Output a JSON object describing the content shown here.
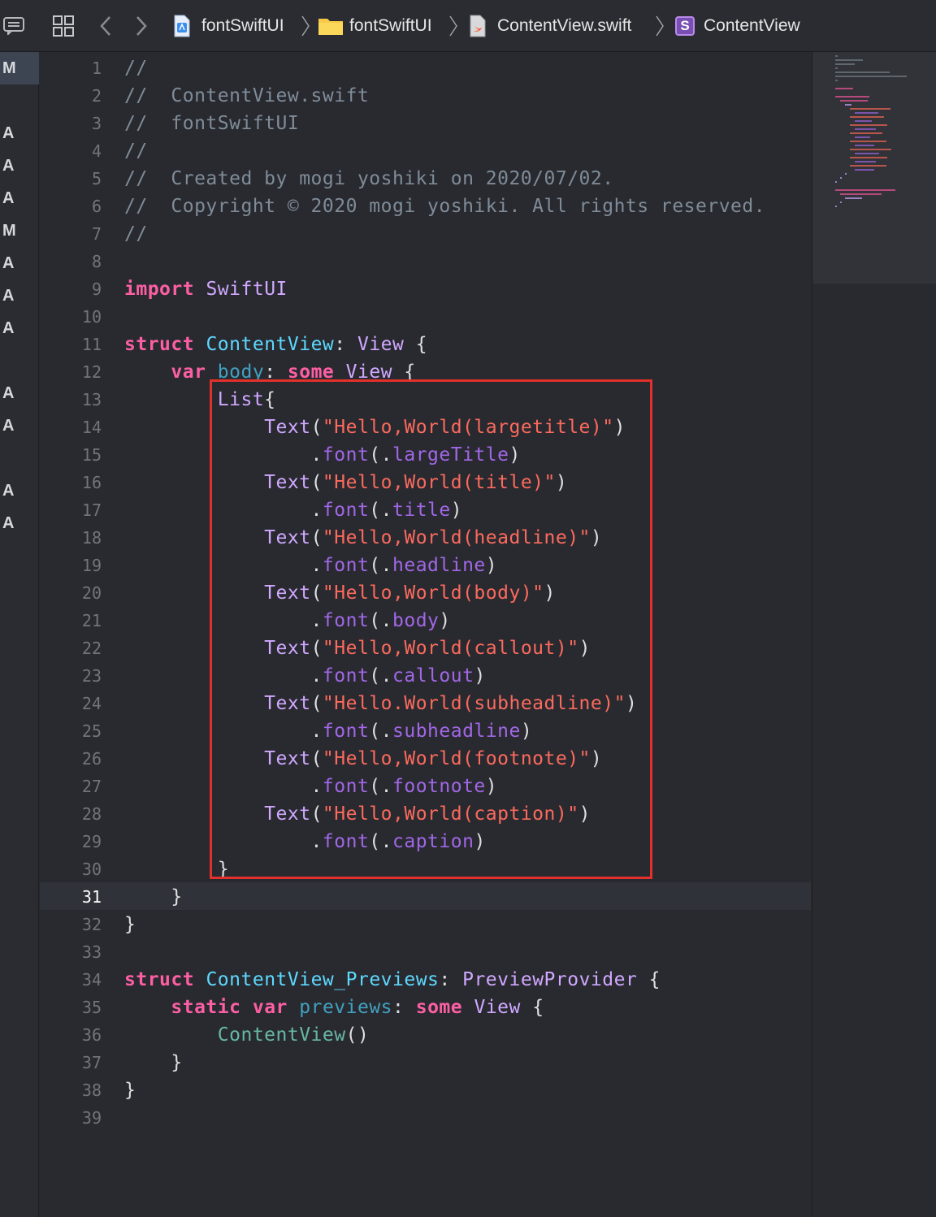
{
  "jumpbar": {
    "crumbs": [
      {
        "label": "fontSwiftUI",
        "icon": "project-file-icon"
      },
      {
        "label": "fontSwiftUI",
        "icon": "folder-icon"
      },
      {
        "label": "ContentView.swift",
        "icon": "swift-file-icon"
      },
      {
        "label": "ContentView",
        "icon": "struct-symbol-icon"
      }
    ],
    "struct_badge": "S"
  },
  "status_markers": [
    "M",
    "A",
    "A",
    "A",
    "M",
    "A",
    "A",
    "A",
    "A",
    "A",
    "A",
    "A"
  ],
  "editor": {
    "current_line": 31,
    "lines": [
      {
        "n": "1",
        "code": "//"
      },
      {
        "n": "2",
        "code": "//  ContentView.swift"
      },
      {
        "n": "3",
        "code": "//  fontSwiftUI"
      },
      {
        "n": "4",
        "code": "//"
      },
      {
        "n": "5",
        "code": "//  Created by mogi yoshiki on 2020/07/02."
      },
      {
        "n": "6",
        "code": "//  Copyright © 2020 mogi yoshiki. All rights reserved."
      },
      {
        "n": "7",
        "code": "//"
      },
      {
        "n": "8",
        "code": ""
      },
      {
        "n": "9",
        "code": "import SwiftUI"
      },
      {
        "n": "10",
        "code": ""
      },
      {
        "n": "11",
        "code": "struct ContentView: View {"
      },
      {
        "n": "12",
        "code": "    var body: some View {"
      },
      {
        "n": "13",
        "code": "        List{"
      },
      {
        "n": "14",
        "code": "            Text(\"Hello,World(largetitle)\")"
      },
      {
        "n": "15",
        "code": "                .font(.largeTitle)"
      },
      {
        "n": "16",
        "code": "            Text(\"Hello,World(title)\")"
      },
      {
        "n": "17",
        "code": "                .font(.title)"
      },
      {
        "n": "18",
        "code": "            Text(\"Hello,World(headline)\")"
      },
      {
        "n": "19",
        "code": "                .font(.headline)"
      },
      {
        "n": "20",
        "code": "            Text(\"Hello,World(body)\")"
      },
      {
        "n": "21",
        "code": "                .font(.body)"
      },
      {
        "n": "22",
        "code": "            Text(\"Hello,World(callout)\")"
      },
      {
        "n": "23",
        "code": "                .font(.callout)"
      },
      {
        "n": "24",
        "code": "            Text(\"Hello.World(subheadline)\")"
      },
      {
        "n": "25",
        "code": "                .font(.subheadline)"
      },
      {
        "n": "26",
        "code": "            Text(\"Hello,World(footnote)\")"
      },
      {
        "n": "27",
        "code": "                .font(.footnote)"
      },
      {
        "n": "28",
        "code": "            Text(\"Hello,World(caption)\")"
      },
      {
        "n": "29",
        "code": "                .font(.caption)"
      },
      {
        "n": "30",
        "code": "        }"
      },
      {
        "n": "31",
        "code": "    }"
      },
      {
        "n": "32",
        "code": "}"
      },
      {
        "n": "33",
        "code": ""
      },
      {
        "n": "34",
        "code": "struct ContentView_Previews: PreviewProvider {"
      },
      {
        "n": "35",
        "code": "    static var previews: some View {"
      },
      {
        "n": "36",
        "code": "        ContentView()"
      },
      {
        "n": "37",
        "code": "    }"
      },
      {
        "n": "38",
        "code": "}"
      },
      {
        "n": "39",
        "code": ""
      }
    ]
  },
  "colors": {
    "background": "#292a30",
    "comment": "#7f8c98",
    "keyword": "#fc5fa3",
    "type": "#d0a8ff",
    "type_decl": "#5dd8ff",
    "string": "#fc6a5d",
    "highlight_box": "#e3302a"
  }
}
